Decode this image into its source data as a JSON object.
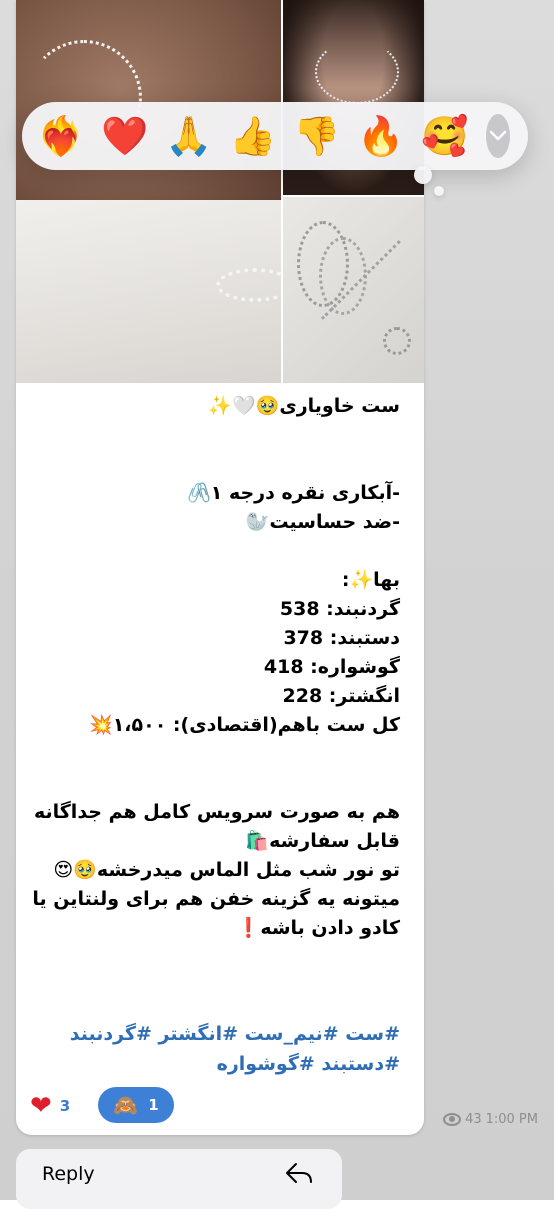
{
  "reaction_bar": {
    "emojis": [
      {
        "name": "heart-on-fire",
        "glyph": "❤️‍🔥"
      },
      {
        "name": "red-heart",
        "glyph": "❤️"
      },
      {
        "name": "folded-hands",
        "glyph": "🙏"
      },
      {
        "name": "thumbs-up",
        "glyph": "👍"
      },
      {
        "name": "thumbs-down",
        "glyph": "👎"
      },
      {
        "name": "fire",
        "glyph": "🔥"
      },
      {
        "name": "smiling-face-with-hearts",
        "glyph": "🥰"
      }
    ],
    "more_icon": "chevron-down-icon"
  },
  "message": {
    "lines": [
      "ست خاویاری🥹🤍✨",
      "",
      "",
      "-آبکاری نقره درجه ۱🖇️",
      "-ضد حساسیت🦭",
      "",
      "بها✨:",
      " گردنبند: 538",
      "دستبند: 378",
      "گوشواره: 418",
      "انگشتر: 228",
      "کل ست باهم(اقتصادی): ۱،۵۰۰💥",
      "",
      "",
      " هم به صورت سرویس کامل هم جداگانه",
      "قابل سفارشه🛍️",
      "تو نور شب مثل الماس میدرخشه🥹😍",
      " میتونه یه گزینه خفن هم برای ولنتاین یا",
      "کادو دادن باشه❗"
    ],
    "hashtags": [
      "#ست #نیم_ست #انگشتر  #گردنبند",
      "#دستبند #گوشواره"
    ],
    "reactions": {
      "heart": {
        "glyph": "❤",
        "count": "3"
      },
      "monkey": {
        "glyph": "🙈",
        "count": "1"
      }
    },
    "views": "43",
    "time": "1:00 PM"
  },
  "context_menu": {
    "reply_label": "Reply",
    "reply_icon": "reply-arrow-icon"
  },
  "colors": {
    "hashtag": "#2f6db5",
    "reaction_pill": "#3e80d6",
    "meta": "#8e8e93"
  }
}
